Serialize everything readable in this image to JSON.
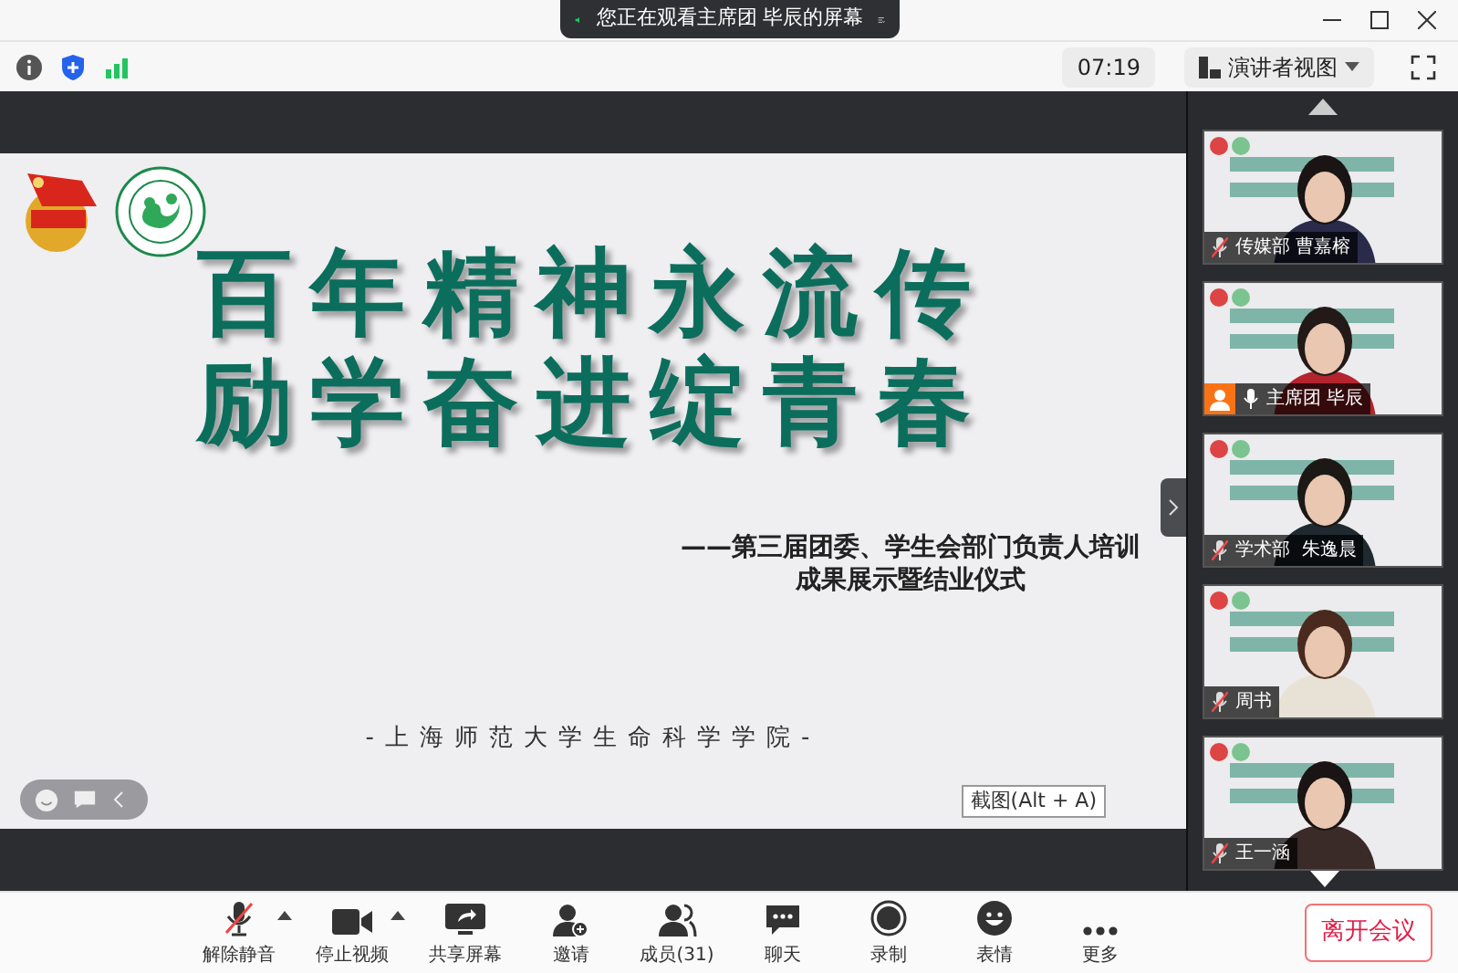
{
  "banner": {
    "text": "您正在观看主席团 毕辰的屏幕"
  },
  "toolbar": {
    "timer": "07:19",
    "view_button": "演讲者视图"
  },
  "slide": {
    "title_lines": [
      "百年精神永流传",
      "励学奋进绽青春"
    ],
    "subtitle_lines": [
      "——第三届团委、学生会部门负责人培训",
      "成果展示暨结业仪式"
    ],
    "footer": "-上海师范大学生命科学学院-"
  },
  "screenshot_hint": "截图(Alt + A)",
  "participants": [
    {
      "name": "传媒部 曹嘉榕",
      "muted": true,
      "host": false
    },
    {
      "name": "主席团 毕辰",
      "muted": false,
      "host": true
    },
    {
      "name": "学术部  朱逸晨",
      "muted": true,
      "host": false
    },
    {
      "name": "周书",
      "muted": true,
      "host": false
    },
    {
      "name": "王一涵",
      "muted": true,
      "host": false
    }
  ],
  "controls": [
    {
      "kind": "mic",
      "label": "解除静音",
      "menu": true
    },
    {
      "kind": "video",
      "label": "停止视频",
      "menu": true
    },
    {
      "kind": "share",
      "label": "共享屏幕",
      "menu": false
    },
    {
      "kind": "invite",
      "label": "邀请",
      "menu": false
    },
    {
      "kind": "members",
      "label": "成员(31)",
      "menu": false
    },
    {
      "kind": "chat",
      "label": "聊天",
      "menu": false
    },
    {
      "kind": "record",
      "label": "录制",
      "menu": false
    },
    {
      "kind": "emoji",
      "label": "表情",
      "menu": false
    },
    {
      "kind": "more",
      "label": "更多",
      "menu": false
    }
  ],
  "leave_button": "离开会议"
}
